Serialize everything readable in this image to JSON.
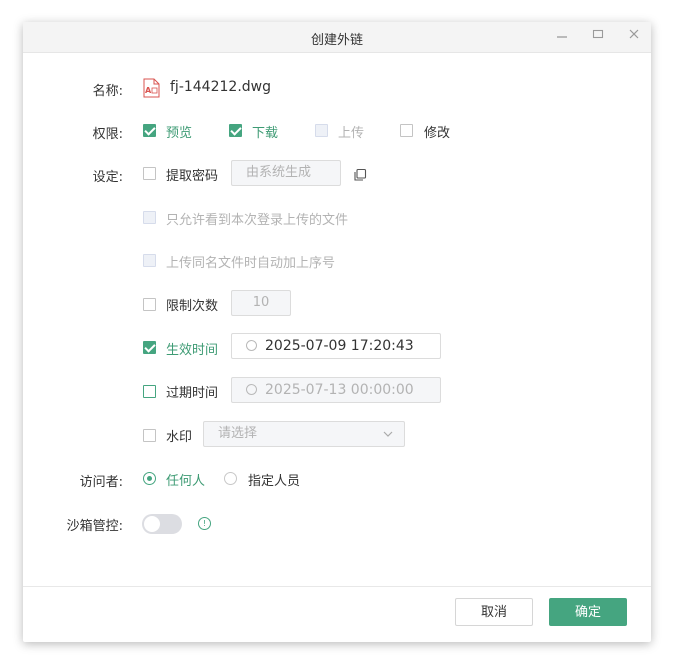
{
  "window": {
    "title": "创建外链",
    "minimize": "—",
    "maximize": "□",
    "close": "✕"
  },
  "form": {
    "name_label": "名称:",
    "file_name": "fj-144212.dwg",
    "permission_label": "权限:",
    "permissions": [
      {
        "label": "预览",
        "checked": true
      },
      {
        "label": "下载",
        "checked": true
      },
      {
        "label": "上传",
        "checked": false,
        "disabled": true
      },
      {
        "label": "修改",
        "checked": false
      }
    ],
    "settings_label": "设定:",
    "password_label": "提取密码",
    "password_placeholder": "由系统生成",
    "only_own_uploads": "只允许看到本次登录上传的文件",
    "auto_sequence": "上传同名文件时自动加上序号",
    "limit_count_label": "限制次数",
    "limit_count_value": "10",
    "effective_time_label": "生效时间",
    "effective_time_value": "2025-07-09 17:20:43",
    "expire_time_label": "过期时间",
    "expire_time_value": "2025-07-13 00:00:00",
    "watermark_label": "水印",
    "watermark_placeholder": "请选择",
    "visitor_label": "访问者:",
    "visitor_options": [
      {
        "label": "任何人",
        "selected": true
      },
      {
        "label": "指定人员",
        "selected": false
      }
    ],
    "sandbox_label": "沙箱管控:",
    "sandbox_enabled": false,
    "info_glyph": "!"
  },
  "footer": {
    "cancel": "取消",
    "ok": "确定"
  },
  "colors": {
    "accent": "#45a580",
    "disabled": "#b3b3b3"
  },
  "icons": [
    "dwg-file-icon",
    "copy-icon",
    "clock-icon",
    "chevron-down-icon",
    "info-icon"
  ]
}
